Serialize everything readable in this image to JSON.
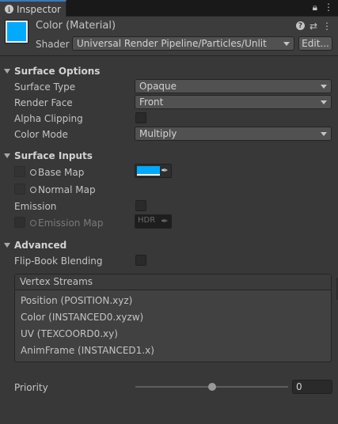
{
  "tab": {
    "title": "Inspector",
    "icon": "info-icon"
  },
  "header": {
    "title": "Color (Material)",
    "shader_label": "Shader",
    "shader_value": "Universal Render Pipeline/Particles/Unlit",
    "edit_label": "Edit...",
    "material_color": "#00aaff"
  },
  "surface_options": {
    "title": "Surface Options",
    "surface_type": {
      "label": "Surface Type",
      "value": "Opaque"
    },
    "render_face": {
      "label": "Render Face",
      "value": "Front"
    },
    "alpha_clipping": {
      "label": "Alpha Clipping",
      "checked": false
    },
    "color_mode": {
      "label": "Color Mode",
      "value": "Multiply"
    }
  },
  "surface_inputs": {
    "title": "Surface Inputs",
    "base_map": {
      "label": "Base Map",
      "color": "#00aaff"
    },
    "normal_map": {
      "label": "Normal Map"
    },
    "emission": {
      "label": "Emission",
      "checked": false
    },
    "emission_map": {
      "label": "Emission Map",
      "hdr_label": "HDR"
    }
  },
  "advanced": {
    "title": "Advanced",
    "flip_book": {
      "label": "Flip-Book Blending",
      "checked": false
    },
    "vertex_streams": {
      "title": "Vertex Streams",
      "items": [
        "Position (POSITION.xyz)",
        "Color (INSTANCED0.xyzw)",
        "UV (TEXCOORD0.xy)",
        "AnimFrame (INSTANCED1.x)"
      ]
    },
    "priority": {
      "label": "Priority",
      "value": "0",
      "slider_fraction": 0.5
    }
  }
}
